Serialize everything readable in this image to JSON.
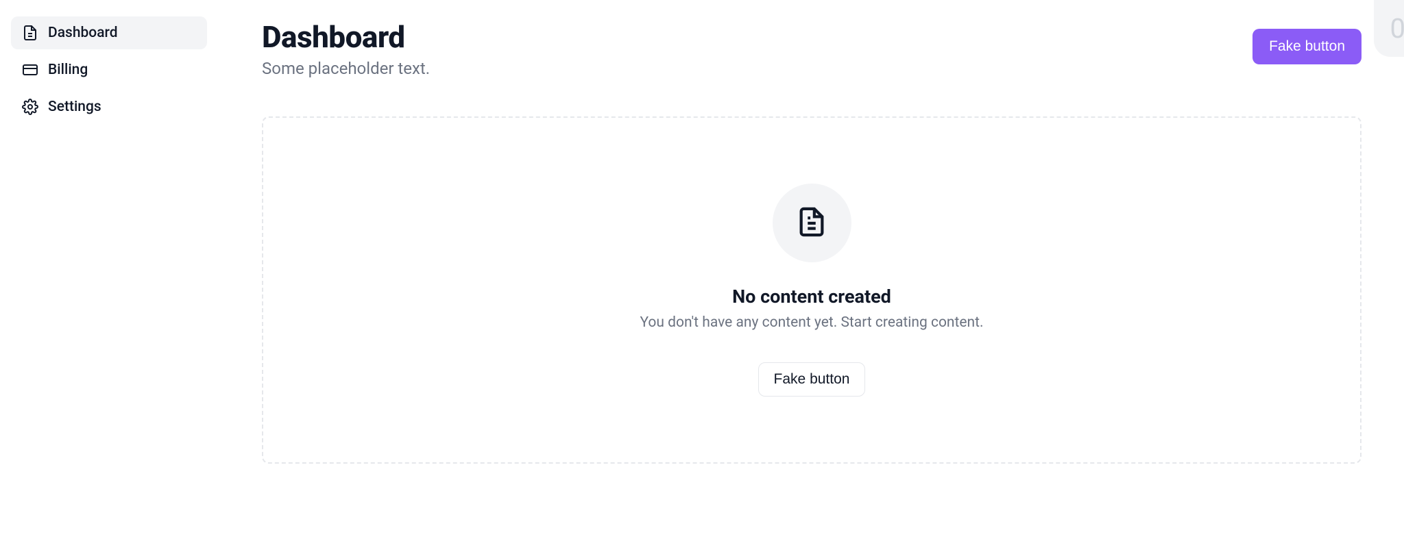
{
  "sidebar": {
    "items": [
      {
        "label": "Dashboard",
        "icon": "file-text-icon",
        "active": true
      },
      {
        "label": "Billing",
        "icon": "credit-card-icon",
        "active": false
      },
      {
        "label": "Settings",
        "icon": "gear-icon",
        "active": false
      }
    ]
  },
  "header": {
    "title": "Dashboard",
    "subtitle": "Some placeholder text.",
    "primary_button_label": "Fake button"
  },
  "empty_state": {
    "title": "No content created",
    "subtitle": "You don't have any content yet. Start creating content.",
    "button_label": "Fake button"
  },
  "corner_badge": "0"
}
